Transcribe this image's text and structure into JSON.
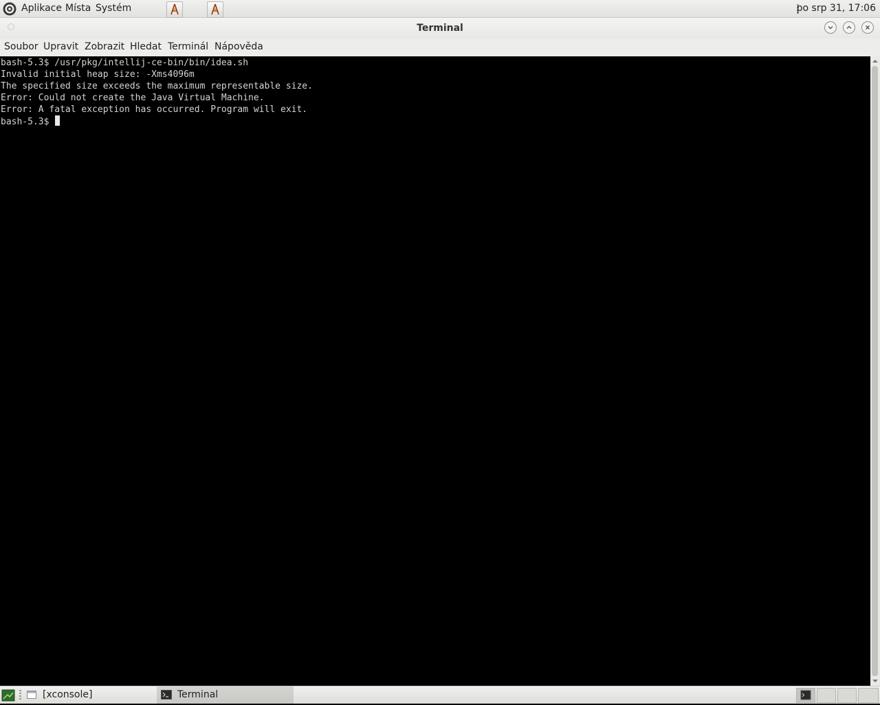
{
  "top_panel": {
    "menus": [
      "Aplikace",
      "Místa",
      "Systém"
    ],
    "launchers": [
      "terminal-launcher-icon",
      "terminal-launcher-icon"
    ],
    "clock": "po srp 31, 17:06"
  },
  "window": {
    "title": "Terminal",
    "controls": [
      "minimize-icon",
      "maximize-icon",
      "close-icon"
    ]
  },
  "menubar": {
    "items": [
      "Soubor",
      "Upravit",
      "Zobrazit",
      "Hledat",
      "Terminál",
      "Nápověda"
    ]
  },
  "terminal": {
    "lines": [
      "bash-5.3$ /usr/pkg/intellij-ce-bin/bin/idea.sh",
      "Invalid initial heap size: -Xms4096m",
      "The specified size exceeds the maximum representable size.",
      "Error: Could not create the Java Virtual Machine.",
      "Error: A fatal exception has occurred. Program will exit."
    ],
    "prompt": "bash-5.3$ "
  },
  "taskbar": {
    "tasks": [
      "[xconsole]",
      "Terminal"
    ]
  },
  "colors": {
    "terminal_bg": "#000000",
    "terminal_fg": "#d3d3d3",
    "panel_bg": "#ececea"
  }
}
